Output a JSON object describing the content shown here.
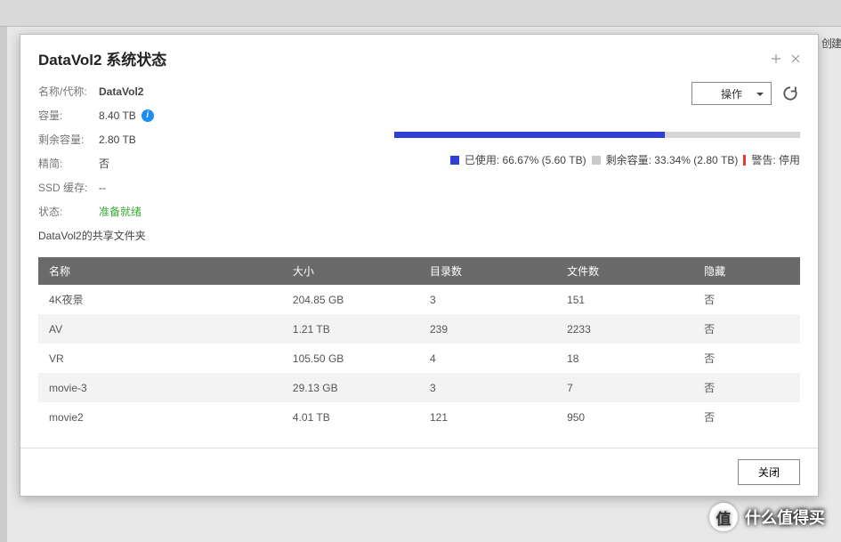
{
  "bg": {
    "truncated_btn": "创建"
  },
  "header": {
    "title": "DataVol2  系统状态"
  },
  "info": {
    "name_lbl": "名称/代称:",
    "name_val": "DataVol2",
    "cap_lbl": "容量:",
    "cap_val": "8.40 TB",
    "free_lbl": "剩余容量:",
    "free_val": "2.80 TB",
    "thin_lbl": "精简:",
    "thin_val": "否",
    "ssd_lbl": "SSD 缓存:",
    "ssd_val": "--",
    "status_lbl": "状态:",
    "status_val": "准备就绪",
    "shared": "DataVol2的共享文件夹"
  },
  "actions": {
    "action_label": "操作"
  },
  "usage": {
    "fill_pct": 66.67,
    "used_label": "已使用: 66.67% (5.60 TB)",
    "free_label": "剩余容量: 33.34% (2.80 TB)",
    "warn_label": "警告: 停用"
  },
  "table": {
    "cols": [
      "名称",
      "大小",
      "目录数",
      "文件数",
      "隐藏"
    ],
    "rows": [
      {
        "c": [
          "4K夜景",
          "204.85 GB",
          "3",
          "151",
          "否"
        ]
      },
      {
        "c": [
          "AV",
          "1.21 TB",
          "239",
          "2233",
          "否"
        ]
      },
      {
        "c": [
          "VR",
          "105.50 GB",
          "4",
          "18",
          "否"
        ]
      },
      {
        "c": [
          "movie-3",
          "29.13 GB",
          "3",
          "7",
          "否"
        ]
      },
      {
        "c": [
          "movie2",
          "4.01 TB",
          "121",
          "950",
          "否"
        ]
      }
    ]
  },
  "footer": {
    "close": "关闭"
  },
  "watermark": {
    "badge": "值",
    "text": "什么值得买"
  }
}
